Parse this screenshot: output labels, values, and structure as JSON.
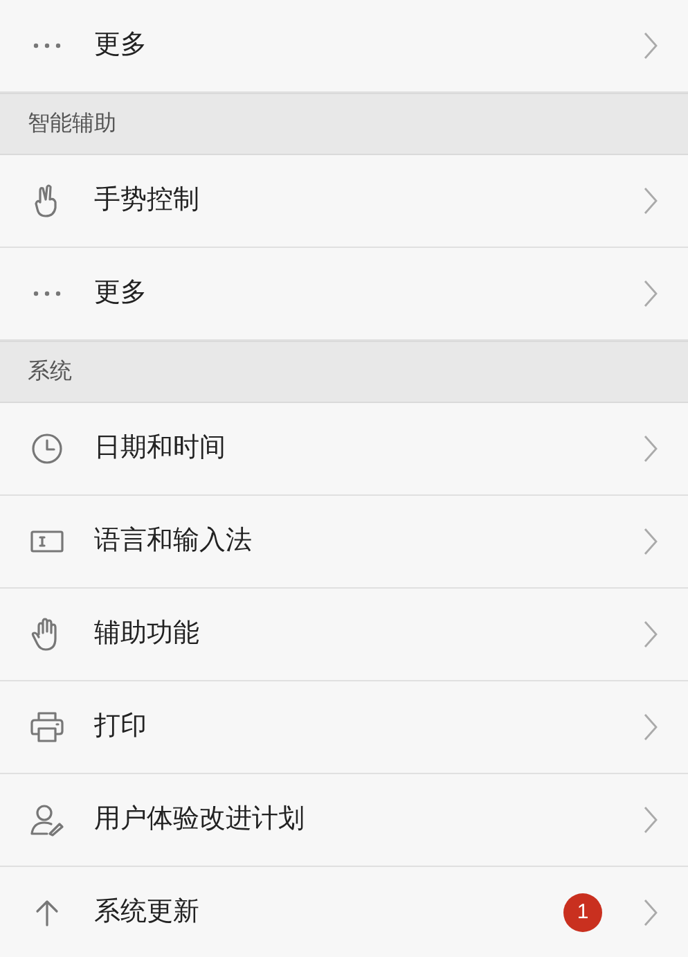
{
  "sections": [
    {
      "items": [
        {
          "kind": "dots",
          "label": "更多"
        }
      ]
    },
    {
      "header": "智能辅助",
      "items": [
        {
          "kind": "gesture",
          "label": "手势控制"
        },
        {
          "kind": "dots",
          "label": "更多"
        }
      ]
    },
    {
      "header": "系统",
      "items": [
        {
          "kind": "clock",
          "label": "日期和时间"
        },
        {
          "kind": "keyboard",
          "label": "语言和输入法"
        },
        {
          "kind": "hand",
          "label": "辅助功能"
        },
        {
          "kind": "printer",
          "label": "打印"
        },
        {
          "kind": "user",
          "label": "用户体验改进计划"
        },
        {
          "kind": "arrow",
          "label": "系统更新",
          "badge": "1"
        }
      ]
    }
  ]
}
